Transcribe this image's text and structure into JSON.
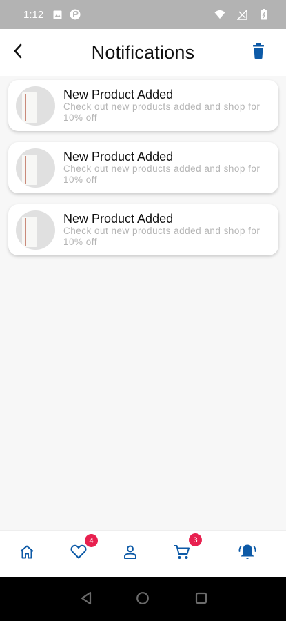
{
  "status_bar": {
    "time": "1:12",
    "icons": [
      "image-icon",
      "app-icon",
      "wifi-icon",
      "no-signal-icon",
      "battery-icon"
    ]
  },
  "header": {
    "title": "Notifications",
    "back_icon": "chevron-left-icon",
    "delete_icon": "trash-icon"
  },
  "notifications": [
    {
      "title": "New Product Added",
      "body": "Check out new products added and shop for 10% off"
    },
    {
      "title": "New Product Added",
      "body": "Check out new products added and shop for 10% off"
    },
    {
      "title": "New Product Added",
      "body": "Check out new products added and shop for 10% off"
    }
  ],
  "bottom_nav": {
    "items": [
      {
        "icon": "home-icon"
      },
      {
        "icon": "heart-icon",
        "badge": "4"
      },
      {
        "icon": "user-icon"
      },
      {
        "icon": "cart-icon",
        "badge": "3"
      },
      {
        "icon": "bell-icon",
        "active": true
      }
    ]
  },
  "colors": {
    "accent": "#0d5aa7",
    "badge": "#e8204f",
    "status_bar": "#b3b3b3",
    "body_text": "#b5b5b5"
  }
}
